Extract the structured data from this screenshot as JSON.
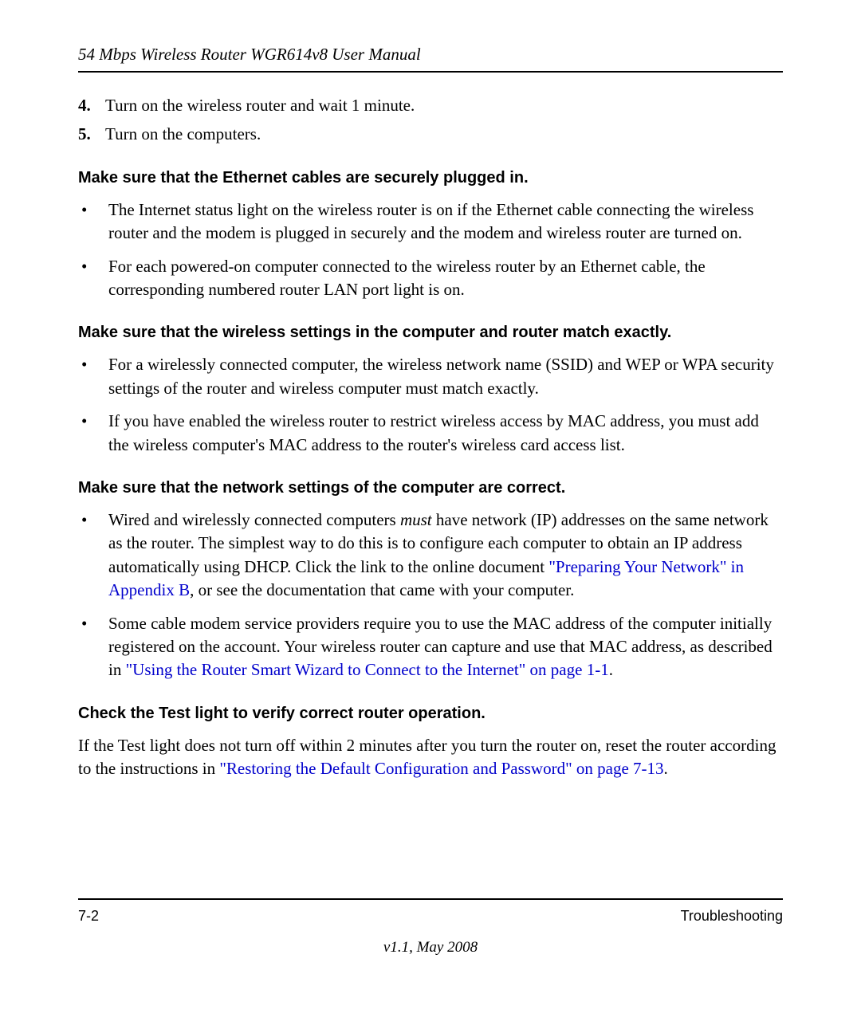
{
  "header": {
    "running_title": "54 Mbps Wireless Router WGR614v8 User Manual"
  },
  "steps": [
    {
      "num": "4.",
      "text": "Turn on the wireless router and wait 1 minute."
    },
    {
      "num": "5.",
      "text": "Turn on the computers."
    }
  ],
  "sections": {
    "s1": {
      "heading": "Make sure that the Ethernet cables are securely plugged in.",
      "bullets": [
        "The Internet status light on the wireless router is on if the Ethernet cable connecting the wireless router and the modem is plugged in securely and the modem and wireless router are turned on.",
        "For each powered-on computer connected to the wireless router by an Ethernet cable, the corresponding numbered router LAN port light is on."
      ]
    },
    "s2": {
      "heading": "Make sure that the wireless settings in the computer and router match exactly.",
      "bullets": [
        "For a wirelessly connected computer, the wireless network name (SSID) and WEP or WPA security settings of the router and wireless computer must match exactly.",
        "If you have enabled the wireless router to restrict wireless access by MAC address, you must add the wireless computer's MAC address to the router's wireless card access list."
      ]
    },
    "s3": {
      "heading": "Make sure that the network settings of the computer are correct.",
      "b1": {
        "pre": "Wired and wirelessly connected computers ",
        "ital": "must",
        "mid": " have network (IP) addresses on the same network as the router. The simplest way to do this is to configure each computer to obtain an IP address automatically using DHCP. Click the link to the online document ",
        "link": "\"Preparing Your Network\" in Appendix B",
        "post": ", or see the documentation that came with your computer."
      },
      "b2": {
        "pre": "Some cable modem service providers require you to use the MAC address of the computer initially registered on the account. Your wireless router can capture and use that MAC address, as described in ",
        "link": "\"Using the Router Smart Wizard to Connect to the Internet\" on page 1-1",
        "post": "."
      }
    },
    "s4": {
      "heading": "Check the Test light to verify correct router operation.",
      "para": {
        "pre": "If the Test light does not turn off within 2 minutes after you turn the router on, reset the router according to the instructions in ",
        "link": "\"Restoring the Default Configuration and Password\" on page 7-13",
        "post": "."
      }
    }
  },
  "footer": {
    "page": "7-2",
    "section": "Troubleshooting",
    "version": "v1.1, May 2008"
  }
}
